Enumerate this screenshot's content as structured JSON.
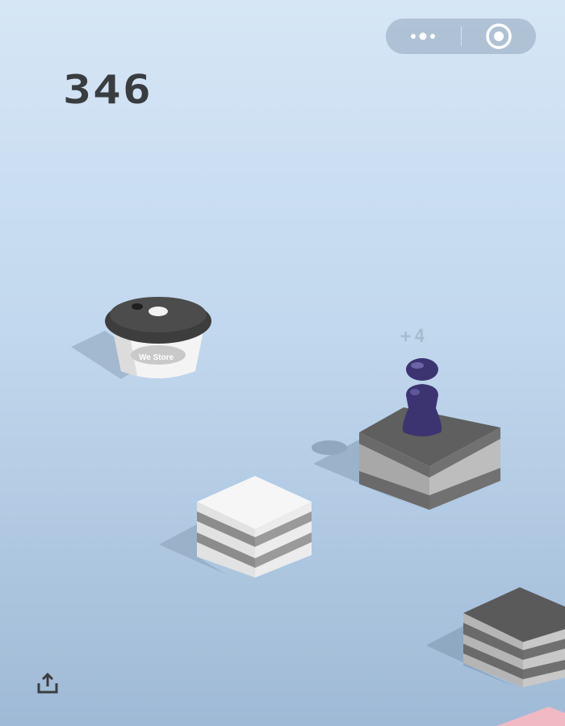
{
  "game": {
    "score": "346",
    "bonus_text": "+4"
  },
  "cup": {
    "brand_text": "We Store"
  },
  "colors": {
    "sky_top": "#d6e6f5",
    "sky_bottom": "#9fbad6",
    "score_color": "#3a3d40",
    "piece_color": "#3c3470"
  },
  "icons": {
    "menu": "more-dots-icon",
    "close": "target-circle-icon",
    "share": "share-icon"
  }
}
